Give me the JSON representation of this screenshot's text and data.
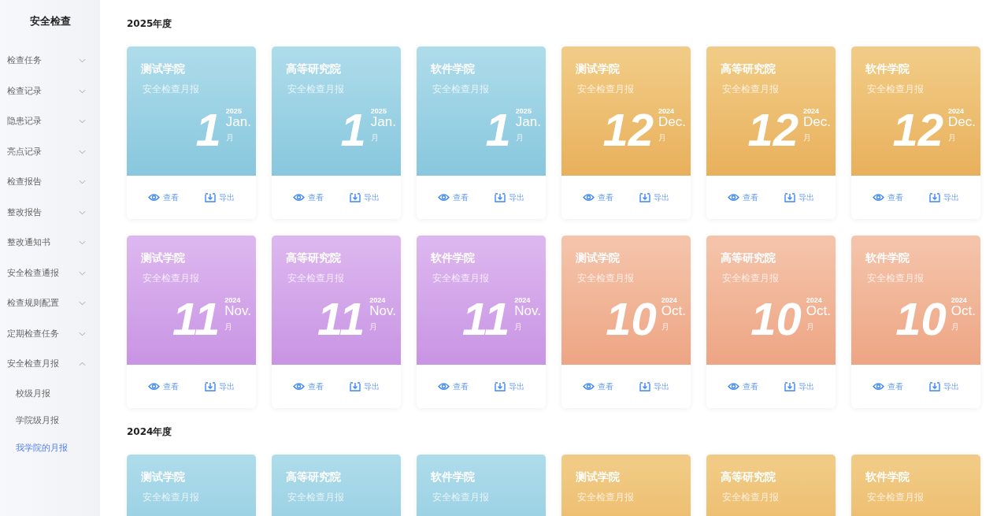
{
  "sidebar": {
    "title": "安全检查",
    "items": [
      {
        "label": "检查任务",
        "expanded": false
      },
      {
        "label": "检查记录",
        "expanded": false
      },
      {
        "label": "隐患记录",
        "expanded": false
      },
      {
        "label": "亮点记录",
        "expanded": false
      },
      {
        "label": "检查报告",
        "expanded": false
      },
      {
        "label": "整改报告",
        "expanded": false
      },
      {
        "label": "整改通知书",
        "expanded": false
      },
      {
        "label": "安全检查通报",
        "expanded": false
      },
      {
        "label": "检查规则配置",
        "expanded": false
      },
      {
        "label": "定期检查任务",
        "expanded": false
      },
      {
        "label": "安全检查月报",
        "expanded": true,
        "children": [
          {
            "label": "校级月报",
            "selected": false
          },
          {
            "label": "学院级月报",
            "selected": false
          },
          {
            "label": "我学院的月报",
            "selected": true
          }
        ]
      }
    ]
  },
  "sections": [
    {
      "title": "2025年度",
      "cards": [
        {
          "college": "测试学院",
          "subtitle": "安全检查月报",
          "color": "#acdbea",
          "month": "1",
          "year": "2025",
          "month_en": "Jan.",
          "month_cn": "月",
          "view": "查看",
          "export": "导出"
        },
        {
          "college": "高等研究院",
          "subtitle": "安全检查月报",
          "color": "#acdbea",
          "month": "1",
          "year": "2025",
          "month_en": "Jan.",
          "month_cn": "月",
          "view": "查看",
          "export": "导出"
        },
        {
          "college": "软件学院",
          "subtitle": "安全检查月报",
          "color": "#acdbea",
          "month": "1",
          "year": "2025",
          "month_en": "Jan.",
          "month_cn": "月",
          "view": "查看",
          "export": "导出"
        },
        {
          "college": "测试学院",
          "subtitle": "安全检查月报",
          "color": "#f1cb85",
          "month": "12",
          "year": "2024",
          "month_en": "Dec.",
          "month_cn": "月",
          "view": "查看",
          "export": "导出"
        },
        {
          "college": "高等研究院",
          "subtitle": "安全检查月报",
          "color": "#f1cb85",
          "month": "12",
          "year": "2024",
          "month_en": "Dec.",
          "month_cn": "月",
          "view": "查看",
          "export": "导出"
        },
        {
          "college": "软件学院",
          "subtitle": "安全检查月报",
          "color": "#f1cb85",
          "month": "12",
          "year": "2024",
          "month_en": "Dec.",
          "month_cn": "月",
          "view": "查看",
          "export": "导出"
        },
        {
          "college": "测试学院",
          "subtitle": "安全检查月报",
          "color": "#dcb6ee",
          "month": "11",
          "year": "2024",
          "month_en": "Nov.",
          "month_cn": "月",
          "view": "查看",
          "export": "导出"
        },
        {
          "college": "高等研究院",
          "subtitle": "安全检查月报",
          "color": "#dcb6ee",
          "month": "11",
          "year": "2024",
          "month_en": "Nov.",
          "month_cn": "月",
          "view": "查看",
          "export": "导出"
        },
        {
          "college": "软件学院",
          "subtitle": "安全检查月报",
          "color": "#dcb6ee",
          "month": "11",
          "year": "2024",
          "month_en": "Nov.",
          "month_cn": "月",
          "view": "查看",
          "export": "导出"
        },
        {
          "college": "测试学院",
          "subtitle": "安全检查月报",
          "color": "#f4c3a9",
          "month": "10",
          "year": "2024",
          "month_en": "Oct.",
          "month_cn": "月",
          "view": "查看",
          "export": "导出"
        },
        {
          "college": "高等研究院",
          "subtitle": "安全检查月报",
          "color": "#f4c3a9",
          "month": "10",
          "year": "2024",
          "month_en": "Oct.",
          "month_cn": "月",
          "view": "查看",
          "export": "导出"
        },
        {
          "college": "软件学院",
          "subtitle": "安全检查月报",
          "color": "#f4c3a9",
          "month": "10",
          "year": "2024",
          "month_en": "Oct.",
          "month_cn": "月",
          "view": "查看",
          "export": "导出"
        }
      ]
    },
    {
      "title": "2024年度",
      "cards": [
        {
          "college": "测试学院",
          "subtitle": "安全检查月报",
          "color": "#acdbea"
        },
        {
          "college": "高等研究院",
          "subtitle": "安全检查月报",
          "color": "#acdbea"
        },
        {
          "college": "软件学院",
          "subtitle": "安全检查月报",
          "color": "#acdbea"
        },
        {
          "college": "测试学院",
          "subtitle": "安全检查月报",
          "color": "#f1cb85"
        },
        {
          "college": "高等研究院",
          "subtitle": "安全检查月报",
          "color": "#f1cb85"
        },
        {
          "college": "软件学院",
          "subtitle": "安全检查月报",
          "color": "#f1cb85"
        }
      ]
    }
  ]
}
